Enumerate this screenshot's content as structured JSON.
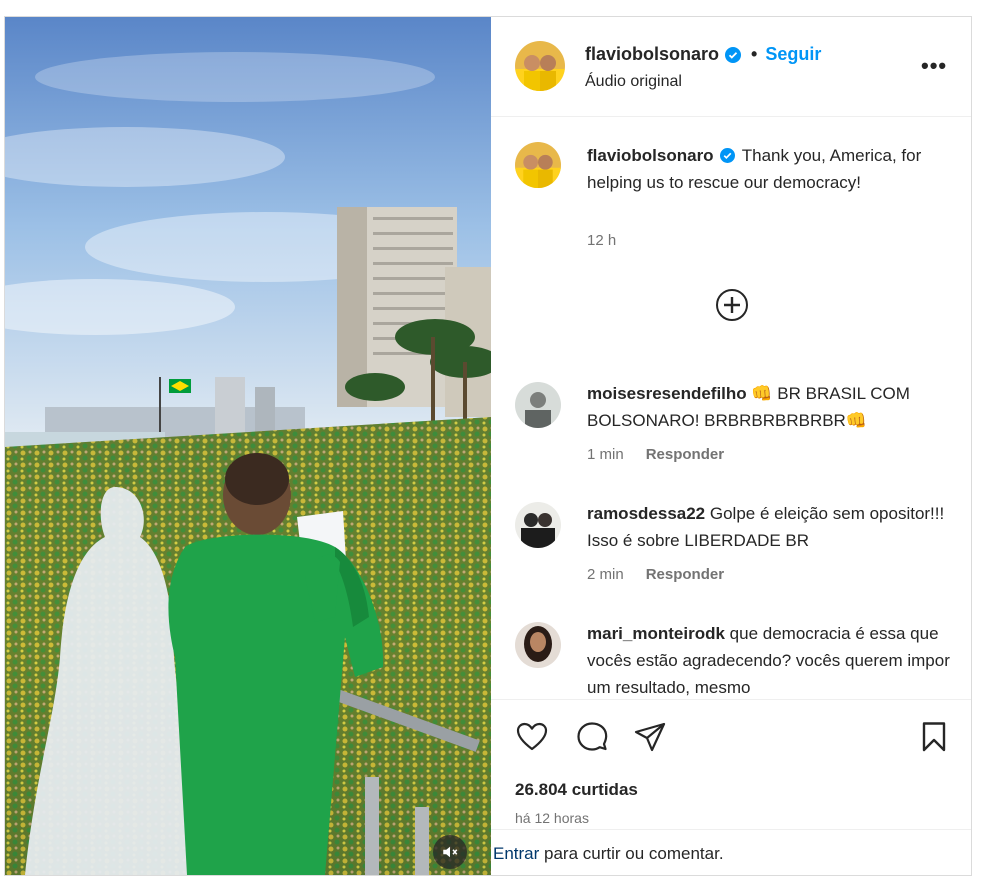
{
  "header": {
    "username": "flaviobolsonaro",
    "separator": "•",
    "follow_label": "Seguir",
    "audio_label": "Áudio original",
    "more_label": "•••"
  },
  "caption": {
    "username": "flaviobolsonaro",
    "text": "Thank you, America, for helping us to rescue our democracy!",
    "time": "12 h"
  },
  "comments": [
    {
      "username": "moisesresendefilho",
      "text": "👊 BR BRASIL COM BOLSONARO! BRBRBRBRBRBR👊",
      "time": "1 min",
      "reply_label": "Responder"
    },
    {
      "username": "ramosdessa22",
      "text": "Golpe é eleição sem opositor!!! Isso é sobre LIBERDADE BR",
      "time": "2 min",
      "reply_label": "Responder"
    },
    {
      "username": "mari_monteirodk",
      "text": "que democracia é essa que vocês estão agradecendo? vocês querem impor um resultado, mesmo"
    }
  ],
  "stats": {
    "likes": "26.804 curtidas",
    "posted": "há 12 horas"
  },
  "login_bar": {
    "link_label": "Entrar",
    "text": " para curtir ou comentar."
  },
  "colors": {
    "accent": "#0095f6",
    "verified": "#0095f6",
    "shirt": "#1fa34a",
    "flag_green": "#009c3b",
    "flag_yellow": "#ffdf00"
  },
  "icons": [
    "verified-icon",
    "more-icon",
    "add-circle-icon",
    "heart-icon",
    "comment-icon",
    "share-icon",
    "bookmark-icon",
    "mute-icon"
  ]
}
